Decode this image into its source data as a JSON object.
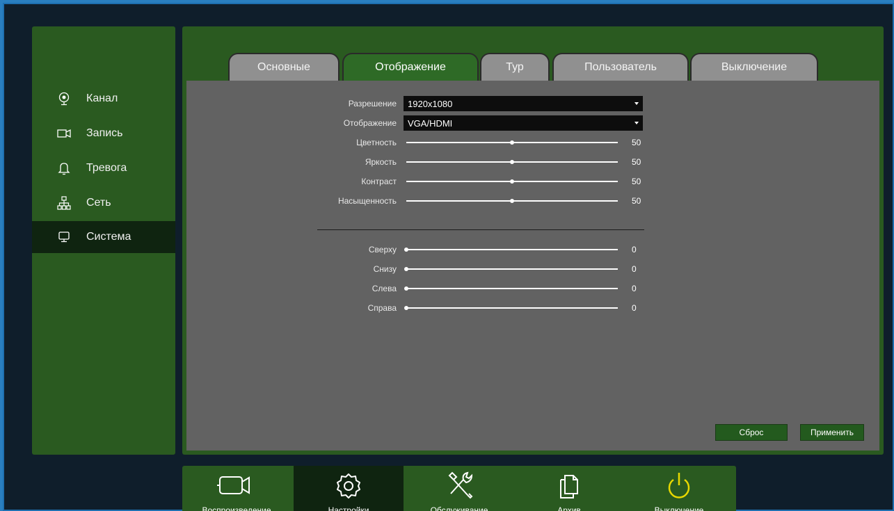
{
  "sidebar": {
    "items": [
      {
        "label": "Канал",
        "icon": "camera-lens-icon"
      },
      {
        "label": "Запись",
        "icon": "video-record-icon"
      },
      {
        "label": "Тревога",
        "icon": "bell-icon"
      },
      {
        "label": "Сеть",
        "icon": "network-icon"
      },
      {
        "label": "Система",
        "icon": "monitor-icon",
        "active": true
      }
    ]
  },
  "tabs": [
    {
      "label": "Основные"
    },
    {
      "label": "Отображение",
      "active": true
    },
    {
      "label": "Тур"
    },
    {
      "label": "Пользователь"
    },
    {
      "label": "Выключение"
    }
  ],
  "form": {
    "resolution": {
      "label": "Разрешение",
      "value": "1920x1080"
    },
    "display": {
      "label": "Отображение",
      "value": "VGA/HDMI"
    },
    "color": {
      "label": "Цветность",
      "value": "50",
      "fraction": 0.5
    },
    "brightness": {
      "label": "Яркость",
      "value": "50",
      "fraction": 0.5
    },
    "contrast": {
      "label": "Контраст",
      "value": "50",
      "fraction": 0.5
    },
    "saturation": {
      "label": "Насыщенность",
      "value": "50",
      "fraction": 0.5
    },
    "top": {
      "label": "Сверху",
      "value": "0",
      "fraction": 0
    },
    "bottom": {
      "label": "Снизу",
      "value": "0",
      "fraction": 0
    },
    "left": {
      "label": "Слева",
      "value": "0",
      "fraction": 0
    },
    "right": {
      "label": "Справа",
      "value": "0",
      "fraction": 0
    }
  },
  "buttons": {
    "reset": "Сброс",
    "apply": "Применить"
  },
  "bottombar": {
    "items": [
      {
        "label": "Воспроизведение",
        "icon": "video-camera-icon"
      },
      {
        "label": "Настройки",
        "icon": "gear-icon",
        "active": true
      },
      {
        "label": "Обслуживание",
        "icon": "tools-icon"
      },
      {
        "label": "Архив",
        "icon": "documents-icon"
      },
      {
        "label": "Выключение",
        "icon": "power-icon"
      }
    ]
  },
  "colors": {
    "panel": "#2a5a20",
    "active": "#0f2410",
    "content": "#626262",
    "power": "#e8d800"
  }
}
